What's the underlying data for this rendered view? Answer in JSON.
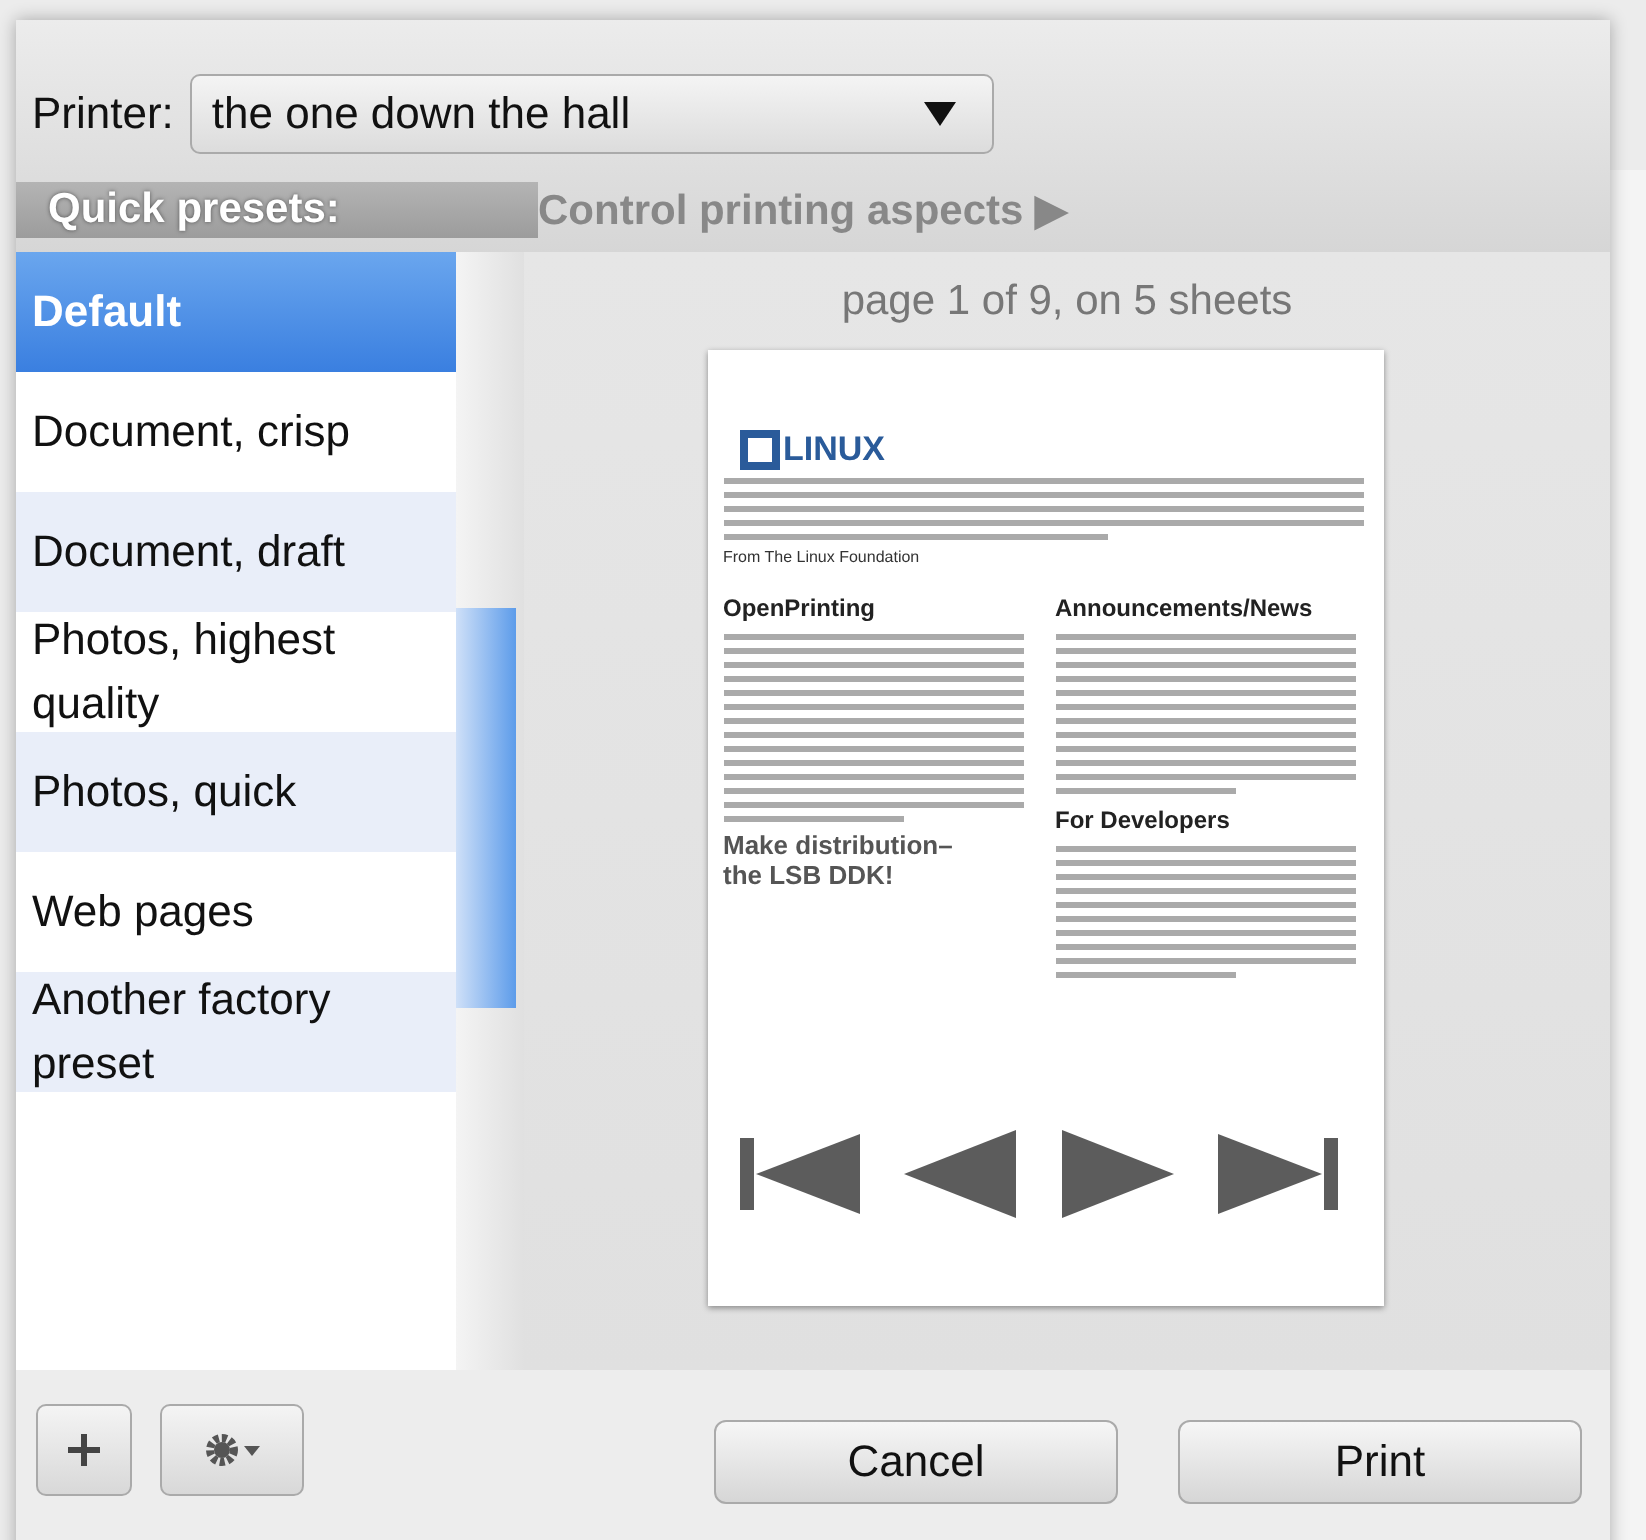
{
  "printer": {
    "label": "Printer:",
    "value": "the one down the hall"
  },
  "presets_heading": "Quick presets:",
  "aspects_link": "Control printing aspects ▶",
  "presets": [
    {
      "label": "Default",
      "selected": true
    },
    {
      "label": "Document, crisp",
      "selected": false
    },
    {
      "label": "Document, draft",
      "selected": false
    },
    {
      "label": "Photos, highest quality",
      "selected": false
    },
    {
      "label": "Photos, quick",
      "selected": false
    },
    {
      "label": "Web pages",
      "selected": false
    },
    {
      "label": "Another factory preset",
      "selected": false
    }
  ],
  "preview": {
    "page_info": "page 1 of 9, on 5 sheets",
    "logo": "LINUX",
    "from": "From The Linux Foundation",
    "heading_left": "OpenPrinting",
    "heading_right": "Announcements/News",
    "heading_dev": "For Developers",
    "promo_top": "Make distribution–",
    "promo_bottom": "the LSB DDK!"
  },
  "buttons": {
    "cancel": "Cancel",
    "print": "Print"
  }
}
